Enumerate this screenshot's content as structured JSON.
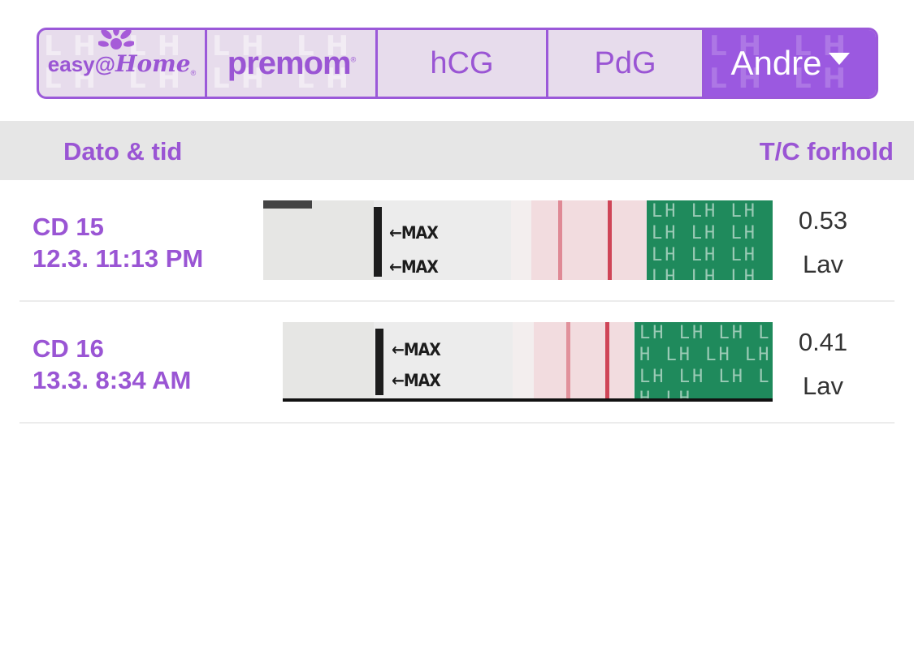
{
  "tabs": {
    "brand1": {
      "left": "easy",
      "at": "@",
      "right": "Home"
    },
    "brand2": {
      "text": "premom"
    },
    "hcg": "hCG",
    "pdg": "PdG",
    "other": "Andre",
    "selected": "other"
  },
  "tab_pattern_text": "LH",
  "header": {
    "date_col": "Dato & tid",
    "ratio_col": "T/C forhold"
  },
  "rows": [
    {
      "cycle_day": "CD 15",
      "datetime": "12.3. 11:13 PM",
      "ratio": "0.53",
      "level": "Lav",
      "strip_label_top": "←MAX",
      "strip_label_bottom": "←MAX",
      "strip_band_text": "LH LH LH LH LH LH LH LH LH LH LH LH"
    },
    {
      "cycle_day": "CD 16",
      "datetime": "13.3. 8:34 AM",
      "ratio": "0.41",
      "level": "Lav",
      "strip_label_top": "←MAX",
      "strip_label_bottom": "←MAX",
      "strip_band_text": "LH LH LH LH LH LH LH LH LH LH LH LH"
    }
  ],
  "colors": {
    "accent": "#9b59d9",
    "tab_bg": "#e7dcec",
    "header_bg": "#e6e6e6",
    "value_text": "#333333",
    "strip_green": "#1f8a5c",
    "strip_line": "#cf4557"
  }
}
